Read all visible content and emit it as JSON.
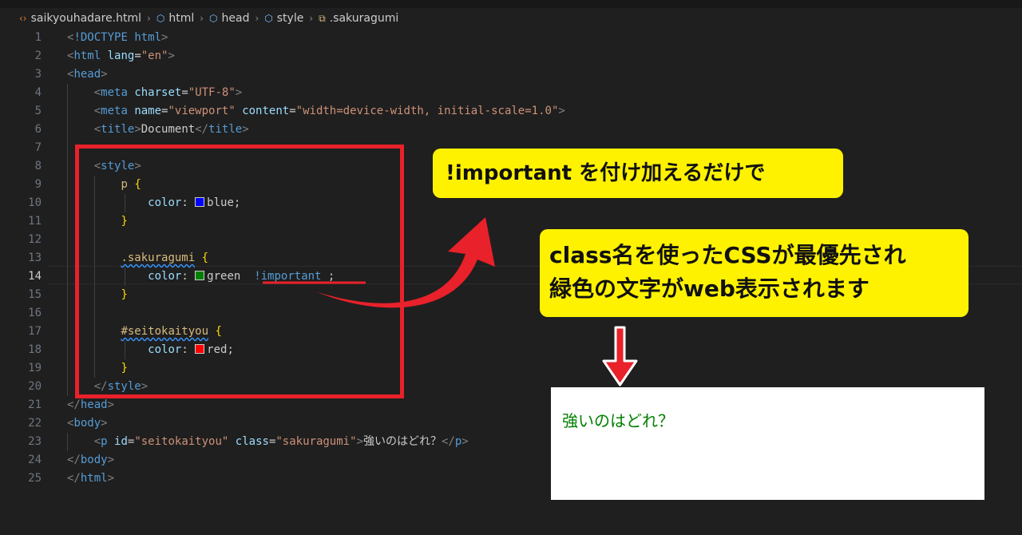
{
  "breadcrumb": [
    {
      "icon": "code-file-icon",
      "glyph": "‹›",
      "label": "saikyouhadare.html",
      "color": "#e37933"
    },
    {
      "icon": "cube-icon",
      "glyph": "⬡",
      "label": "html",
      "color": "#75beff"
    },
    {
      "icon": "cube-icon",
      "glyph": "⬡",
      "label": "head",
      "color": "#75beff"
    },
    {
      "icon": "cube-icon",
      "glyph": "⬡",
      "label": "style",
      "color": "#75beff"
    },
    {
      "icon": "selector-icon",
      "glyph": "⧉",
      "label": ".sakuragumi",
      "color": "#d7ba7d"
    }
  ],
  "code": {
    "active_line": 14,
    "lines": [
      {
        "n": "1",
        "text": "<!DOCTYPE html>"
      },
      {
        "n": "2",
        "text": "<html lang=\"en\">"
      },
      {
        "n": "3",
        "text": "<head>"
      },
      {
        "n": "4",
        "text": "    <meta charset=\"UTF-8\">"
      },
      {
        "n": "5",
        "text": "    <meta name=\"viewport\" content=\"width=device-width, initial-scale=1.0\">"
      },
      {
        "n": "6",
        "text": "    <title>Document</title>"
      },
      {
        "n": "7",
        "text": ""
      },
      {
        "n": "8",
        "text": "    <style>"
      },
      {
        "n": "9",
        "text": "        p {"
      },
      {
        "n": "10",
        "text": "            color: blue;"
      },
      {
        "n": "11",
        "text": "        }"
      },
      {
        "n": "12",
        "text": ""
      },
      {
        "n": "13",
        "text": "        .sakuragumi {"
      },
      {
        "n": "14",
        "text": "            color: green  !important ;"
      },
      {
        "n": "15",
        "text": "        }"
      },
      {
        "n": "16",
        "text": ""
      },
      {
        "n": "17",
        "text": "        #seitokaityou {"
      },
      {
        "n": "18",
        "text": "            color: red;"
      },
      {
        "n": "19",
        "text": "        }"
      },
      {
        "n": "20",
        "text": "    </style>"
      },
      {
        "n": "21",
        "text": "</head>"
      },
      {
        "n": "22",
        "text": "<body>"
      },
      {
        "n": "23",
        "text": "    <p id=\"seitokaityou\" class=\"sakuragumi\">強いのはどれ？</p>"
      },
      {
        "n": "24",
        "text": "</body>"
      },
      {
        "n": "25",
        "text": "</html>"
      }
    ]
  },
  "colors": {
    "swatch_blue": "#0000ff",
    "swatch_green": "#008000",
    "swatch_red": "#ff0000",
    "annotation_red": "#e8212a",
    "callout_yellow": "#fff200"
  },
  "callouts": {
    "first": "!important を付け加えるだけで",
    "second_line1": "class名を使ったCSSが最優先され",
    "second_line2": "緑色の文字がweb表示されます"
  },
  "preview": {
    "text": "強いのはどれ？"
  }
}
